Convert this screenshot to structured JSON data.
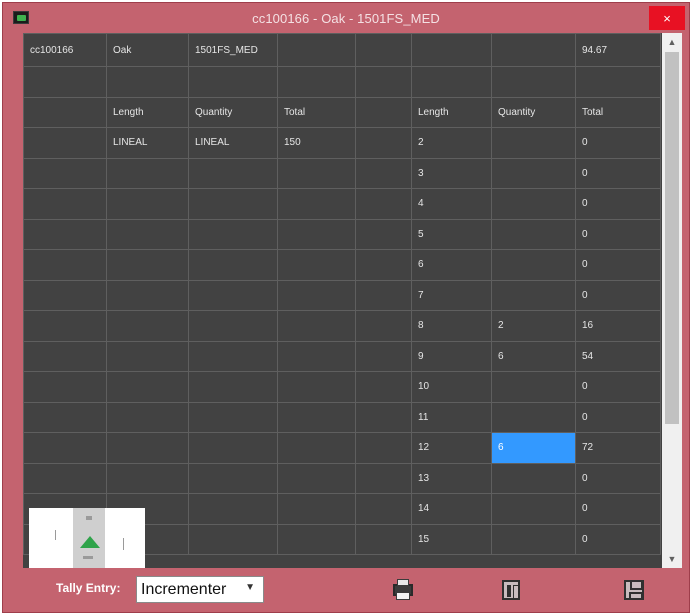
{
  "window": {
    "title": "cc100166 - Oak - 1501FS_MED",
    "close_label": "×"
  },
  "grid": {
    "rows": [
      [
        "cc100166",
        "Oak",
        "1501FS_MED",
        "",
        "",
        "",
        "",
        "94.67"
      ],
      [
        "",
        "",
        "",
        "",
        "",
        "",
        "",
        ""
      ],
      [
        "",
        "Length",
        "Quantity",
        "Total",
        "",
        "Length",
        "Quantity",
        "Total"
      ],
      [
        "",
        "LINEAL",
        "LINEAL",
        "150",
        "",
        "2",
        "",
        "0"
      ],
      [
        "",
        "",
        "",
        "",
        "",
        "3",
        "",
        "0"
      ],
      [
        "",
        "",
        "",
        "",
        "",
        "4",
        "",
        "0"
      ],
      [
        "",
        "",
        "",
        "",
        "",
        "5",
        "",
        "0"
      ],
      [
        "",
        "",
        "",
        "",
        "",
        "6",
        "",
        "0"
      ],
      [
        "",
        "",
        "",
        "",
        "",
        "7",
        "",
        "0"
      ],
      [
        "",
        "",
        "",
        "",
        "",
        "8",
        "2",
        "16"
      ],
      [
        "",
        "",
        "",
        "",
        "",
        "9",
        "6",
        "54"
      ],
      [
        "",
        "",
        "",
        "",
        "",
        "10",
        "",
        "0"
      ],
      [
        "",
        "",
        "",
        "",
        "",
        "11",
        "",
        "0"
      ],
      [
        "",
        "",
        "",
        "",
        "",
        "12",
        "6",
        "72"
      ],
      [
        "",
        "",
        "",
        "",
        "",
        "13",
        "",
        "0"
      ],
      [
        "",
        "",
        "",
        "",
        "",
        "14",
        "",
        "0"
      ],
      [
        "",
        "",
        "",
        "",
        "",
        "15",
        "",
        "0"
      ]
    ],
    "selected_cell": {
      "row": 13,
      "col": 6
    }
  },
  "scrollbar": {
    "up_icon": "▲",
    "down_icon": "▼"
  },
  "toolbar": {
    "tally_label": "Tally Entry:",
    "tally_value": "Incrementer",
    "tally_chevron": "▼",
    "print_icon": "printer-icon",
    "report_icon": "report-icon",
    "save_icon": "save-icon"
  },
  "colors": {
    "window_frame": "#c4636f",
    "grid_background": "#424242",
    "selection": "#3399ff",
    "close_button": "#e81123"
  }
}
